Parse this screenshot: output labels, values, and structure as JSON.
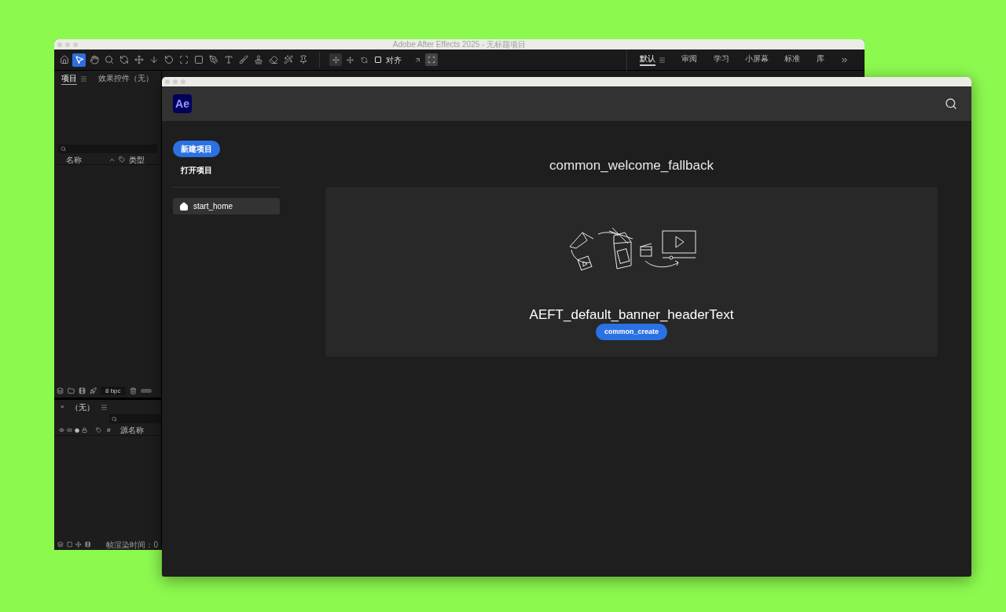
{
  "back_window": {
    "title": "Adobe After Effects 2025 - 无标题项目",
    "tools": [
      {
        "kind": "home",
        "selected": false
      },
      {
        "kind": "pointer",
        "selected": true
      },
      {
        "kind": "hand",
        "selected": false
      },
      {
        "kind": "zoom",
        "selected": false
      },
      {
        "kind": "orbit",
        "selected": false
      },
      {
        "kind": "move",
        "selected": false
      },
      {
        "kind": "dolly",
        "selected": false
      },
      {
        "kind": "rotate",
        "selected": false
      },
      {
        "kind": "anchor",
        "selected": false
      },
      {
        "kind": "rect",
        "selected": false
      },
      {
        "kind": "pen",
        "selected": false
      },
      {
        "kind": "text",
        "selected": false
      },
      {
        "kind": "brush",
        "selected": false
      },
      {
        "kind": "stamp",
        "selected": false
      },
      {
        "kind": "eraser",
        "selected": false
      },
      {
        "kind": "roto",
        "selected": false
      },
      {
        "kind": "pin",
        "selected": false
      }
    ],
    "align": {
      "label": "对齐",
      "checked": false
    },
    "workspaces": [
      {
        "label": "默认",
        "selected": true
      },
      {
        "label": "审阅",
        "selected": false
      },
      {
        "label": "学习",
        "selected": false
      },
      {
        "label": "小屏幕",
        "selected": false
      },
      {
        "label": "标准",
        "selected": false
      },
      {
        "label": "库",
        "selected": false
      }
    ],
    "project_panel": {
      "tabs": [
        {
          "label": "项目",
          "selected": true
        },
        {
          "label": "效果控件（无）",
          "selected": false
        }
      ],
      "columns": [
        "名称",
        "类型"
      ],
      "bit_depth": "8 bpc"
    },
    "timeline": {
      "close": "×",
      "title": "（无）",
      "columns": [
        "#",
        "源名称"
      ],
      "render_time": "帧渲染时间：0"
    }
  },
  "home_window": {
    "logo": "Ae",
    "sidebar": {
      "new_project": "新建项目",
      "open_project": "打开项目",
      "items": [
        {
          "label": "start_home",
          "selected": true
        }
      ]
    },
    "title": "common_welcome_fallback",
    "banner": {
      "header": "AEFT_default_banner_headerText",
      "button": "common_create"
    }
  }
}
